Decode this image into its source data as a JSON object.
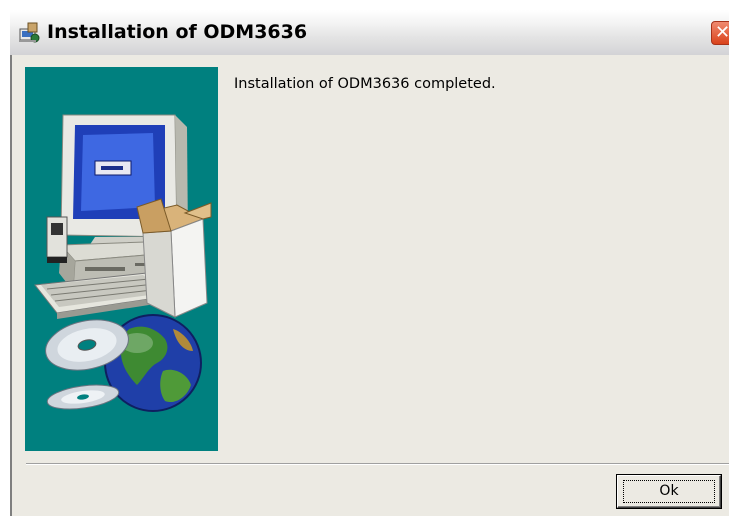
{
  "window": {
    "title": "Installation of ODM3636",
    "close_glyph": "✕"
  },
  "main": {
    "message": "Installation of ODM3636 completed."
  },
  "buttons": {
    "ok_label": "Ok"
  },
  "icons": {
    "title": "installer-icon",
    "close": "close-icon",
    "hero": "computer-box-globe-cd-illustration"
  },
  "colors": {
    "hero_background": "#00807f",
    "close_button": "#d9421b",
    "dialog_background": "#eceae3"
  }
}
